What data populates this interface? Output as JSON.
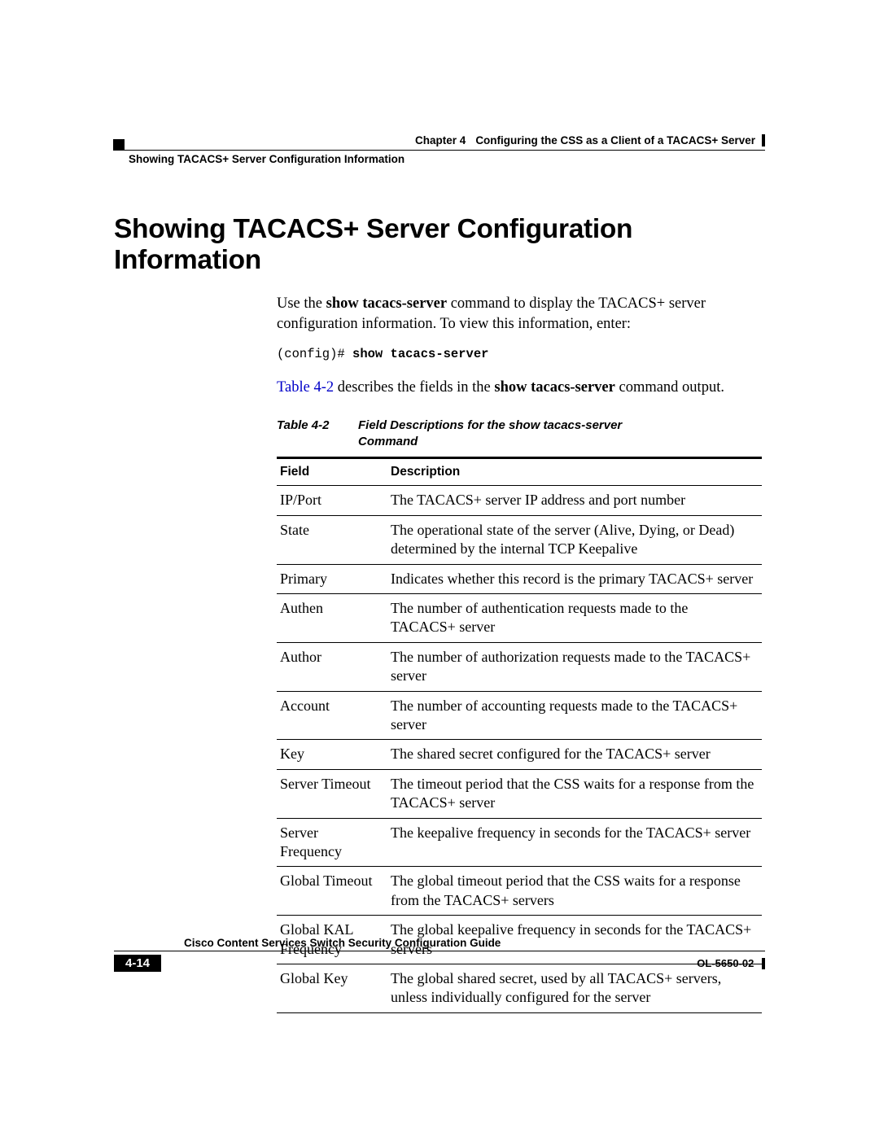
{
  "header": {
    "chapter_label": "Chapter 4",
    "chapter_title": "Configuring the CSS as a Client of a TACACS+ Server",
    "subhead": "Showing TACACS+ Server Configuration Information"
  },
  "heading": "Showing TACACS+ Server Configuration Information",
  "intro": {
    "pre": "Use the ",
    "bold1": "show tacacs-server",
    "post": " command to display the TACACS+ server configuration information. To view this information, enter:"
  },
  "code": {
    "prompt": "(config)# ",
    "command": "show tacacs-server"
  },
  "ref": {
    "link": "Table 4-2",
    "mid": " describes the fields in the ",
    "bold": "show tacacs-server",
    "tail": " command output."
  },
  "table": {
    "caption_label": "Table 4-2",
    "caption_text": "Field Descriptions for the show tacacs-server Command",
    "head_field": "Field",
    "head_desc": "Description",
    "rows": [
      {
        "field": "IP/Port",
        "desc": "The TACACS+ server IP address and port number"
      },
      {
        "field": "State",
        "desc": "The operational state of the server (Alive, Dying, or Dead) determined by the internal TCP Keepalive"
      },
      {
        "field": "Primary",
        "desc": "Indicates whether this record is the primary TACACS+ server"
      },
      {
        "field": "Authen",
        "desc": "The number of authentication requests made to the TACACS+ server"
      },
      {
        "field": "Author",
        "desc": "The number of authorization requests made to the TACACS+ server"
      },
      {
        "field": "Account",
        "desc": "The number of accounting requests made to the TACACS+ server"
      },
      {
        "field": "Key",
        "desc": "The shared secret configured for the TACACS+ server"
      },
      {
        "field": "Server Timeout",
        "desc": "The timeout period that the CSS waits for a response from the TACACS+ server"
      },
      {
        "field": "Server Frequency",
        "desc": "The keepalive frequency in seconds for the TACACS+ server"
      },
      {
        "field": "Global Timeout",
        "desc": "The global timeout period that the CSS waits for a response from the TACACS+ servers"
      },
      {
        "field": "Global KAL Frequency",
        "desc": "The global keepalive frequency in seconds for the TACACS+ servers"
      },
      {
        "field": "Global Key",
        "desc": "The global shared secret, used by all TACACS+ servers, unless individually configured for the server"
      }
    ]
  },
  "footer": {
    "guide_title": "Cisco Content Services Switch Security Configuration Guide",
    "page_num": "4-14",
    "doc_code": "OL-5650-02"
  }
}
